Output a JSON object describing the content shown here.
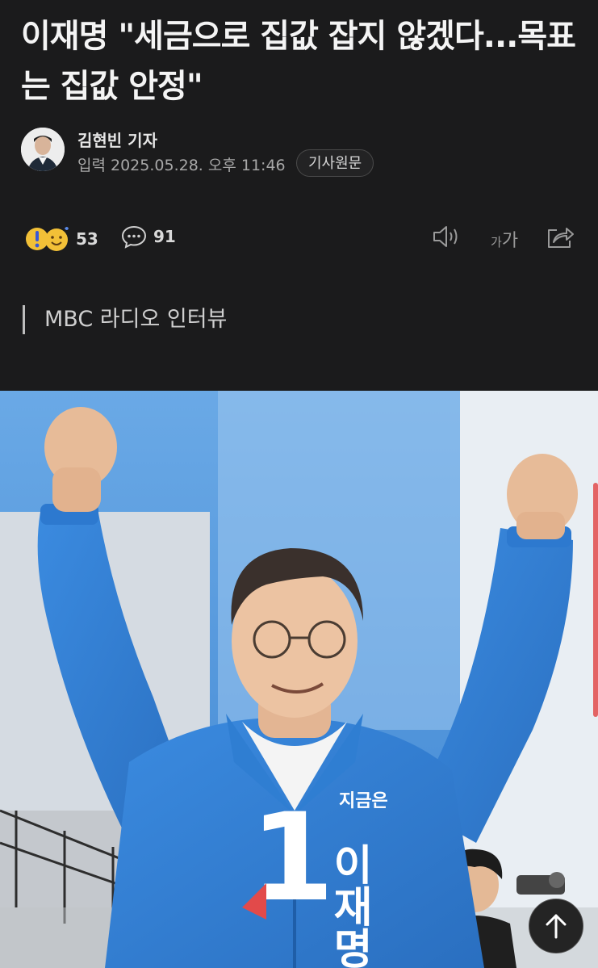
{
  "article": {
    "headline": "이재명 \"세금으로 집값 잡지 않겠다...목표는 집값 안정\"",
    "reporter": "김현빈 기자",
    "date_label": "입력 2025.05.28. 오후 11:46",
    "original_button": "기사원문",
    "subheading": "MBC 라디오 인터뷰"
  },
  "actions": {
    "reaction_count": "53",
    "comment_count": "91",
    "font_size_label": "가가",
    "icons": [
      "reaction-emoji-icon",
      "comment-icon",
      "speaker-icon",
      "font-size-icon",
      "share-icon"
    ]
  },
  "photo": {
    "sign_text": "지금은",
    "sign_name": "이재명",
    "number": "1"
  },
  "colors": {
    "background": "#1b1b1c",
    "jacket_blue": "#2f7ed2",
    "accent_red": "#e24a4a"
  }
}
